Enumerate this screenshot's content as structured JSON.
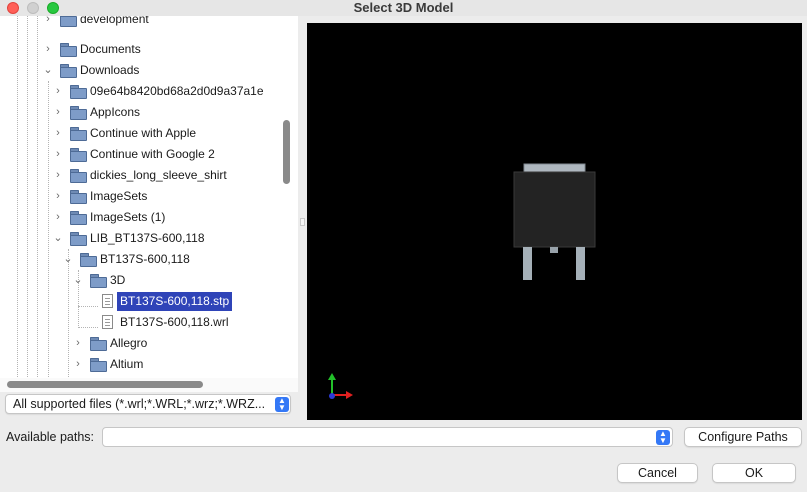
{
  "window": {
    "title": "Select 3D Model"
  },
  "tree": {
    "items": [
      {
        "label": "development",
        "icon": "folder-icon",
        "expanded": false
      },
      {
        "label": "Documents",
        "icon": "folder-icon",
        "expanded": false
      },
      {
        "label": "Downloads",
        "icon": "folder-icon",
        "expanded": true
      },
      {
        "label": "09e64b8420bd68a2d0d9a37a1e",
        "icon": "folder-icon",
        "expanded": false
      },
      {
        "label": "AppIcons",
        "icon": "folder-icon",
        "expanded": false
      },
      {
        "label": "Continue with Apple",
        "icon": "folder-icon",
        "expanded": false
      },
      {
        "label": "Continue with Google 2",
        "icon": "folder-icon",
        "expanded": false
      },
      {
        "label": "dickies_long_sleeve_shirt",
        "icon": "folder-icon",
        "expanded": false
      },
      {
        "label": "ImageSets",
        "icon": "folder-icon",
        "expanded": false
      },
      {
        "label": "ImageSets (1)",
        "icon": "folder-icon",
        "expanded": false
      },
      {
        "label": "LIB_BT137S-600,118",
        "icon": "folder-icon",
        "expanded": true
      },
      {
        "label": "BT137S-600,118",
        "icon": "folder-icon",
        "expanded": true
      },
      {
        "label": "3D",
        "icon": "folder-icon",
        "expanded": true
      },
      {
        "label": "BT137S-600,118.stp",
        "icon": "file-icon",
        "selected": true
      },
      {
        "label": "BT137S-600,118.wrl",
        "icon": "file-icon"
      },
      {
        "label": "Allegro",
        "icon": "folder-icon",
        "expanded": false
      },
      {
        "label": "Altium",
        "icon": "folder-icon",
        "expanded": false
      }
    ]
  },
  "filter": {
    "selected": "All supported files (*.wrl;*.WRL;*.wrz;*.WRZ..."
  },
  "paths": {
    "label": "Available paths:",
    "selected": ""
  },
  "buttons": {
    "configure": "Configure Paths",
    "cancel": "Cancel",
    "ok": "OK"
  },
  "colors": {
    "selection": "#2f44b8",
    "viewer_bg": "#000000",
    "accent": "#3478f6"
  }
}
